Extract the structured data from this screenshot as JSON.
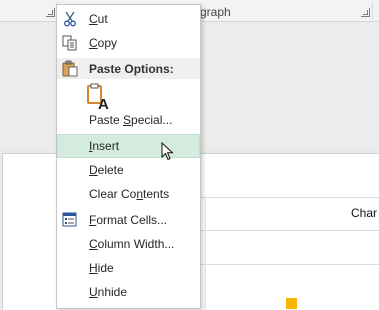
{
  "ribbon": {
    "group_label": "graph"
  },
  "sheet": {
    "right_header": "Char"
  },
  "menu": {
    "items": [
      {
        "id": "cut",
        "label": "Cut",
        "icon": "scissors-icon"
      },
      {
        "id": "copy",
        "label": "Copy",
        "icon": "copy-icon"
      },
      {
        "id": "paste_options",
        "label": "Paste Options:",
        "icon": "paste-clipboard-icon"
      },
      {
        "id": "paste_keep_text",
        "label": "",
        "icon": "paste-keep-text-only-icon"
      },
      {
        "id": "paste_special",
        "label": "Paste Special...",
        "icon": ""
      },
      {
        "id": "insert",
        "label": "Insert",
        "icon": "",
        "state": "hover"
      },
      {
        "id": "delete",
        "label": "Delete",
        "icon": ""
      },
      {
        "id": "clear_contents",
        "label": "Clear Contents",
        "icon": ""
      },
      {
        "id": "format_cells",
        "label": "Format Cells...",
        "icon": "format-cells-icon"
      },
      {
        "id": "column_width",
        "label": "Column Width...",
        "icon": ""
      },
      {
        "id": "hide",
        "label": "Hide",
        "icon": ""
      },
      {
        "id": "unhide",
        "label": "Unhide",
        "icon": ""
      }
    ]
  },
  "colors": {
    "hover_bg": "#d3ecde",
    "accent_orange": "#f7b400",
    "icon_blue": "#2b579a",
    "clipboard_orange": "#d9822b"
  }
}
